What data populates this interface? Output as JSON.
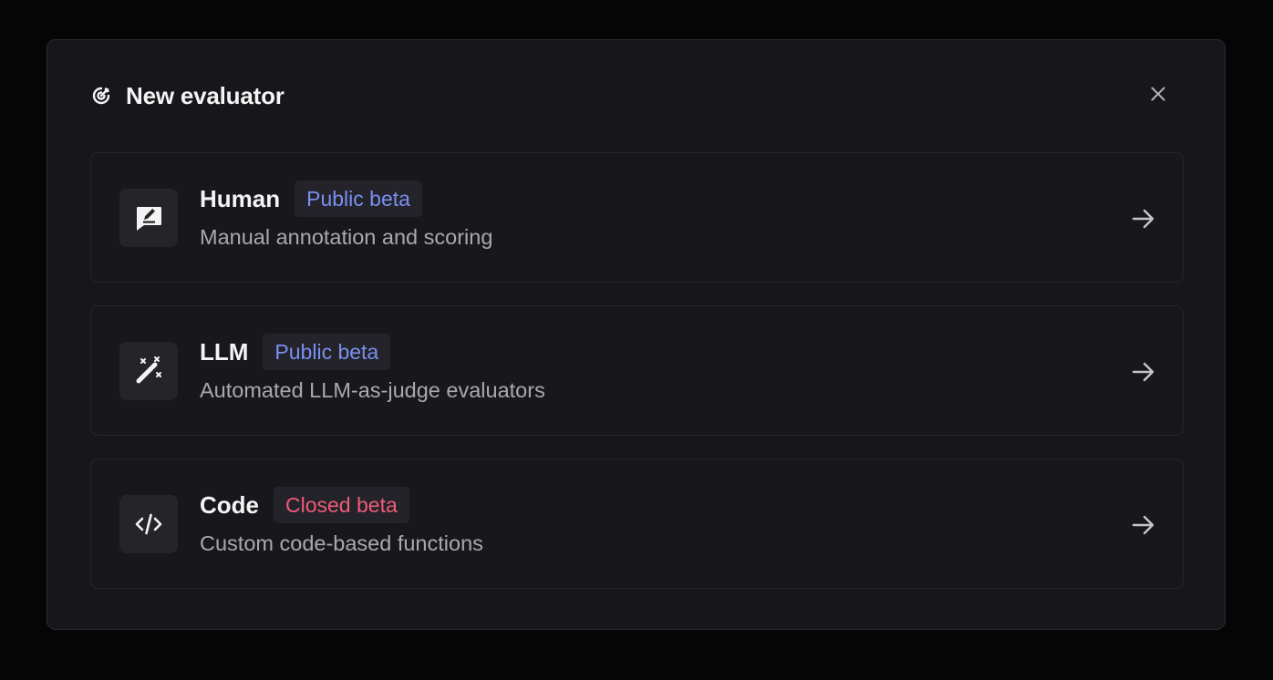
{
  "dialog": {
    "title": "New evaluator",
    "header_icon": "target-icon",
    "close_icon": "close-icon"
  },
  "options": [
    {
      "title": "Human",
      "badge": "Public beta",
      "badge_type": "public",
      "description": "Manual annotation and scoring",
      "icon": "annotate-icon"
    },
    {
      "title": "LLM",
      "badge": "Public beta",
      "badge_type": "public",
      "description": "Automated LLM-as-judge evaluators",
      "icon": "magic-wand-icon"
    },
    {
      "title": "Code",
      "badge": "Closed beta",
      "badge_type": "closed",
      "description": "Custom code-based functions",
      "icon": "code-icon"
    }
  ],
  "colors": {
    "background": "#050506",
    "modal": "#17171b",
    "public_badge_text": "#7a8ff0",
    "closed_badge_text": "#ef5b7a"
  }
}
